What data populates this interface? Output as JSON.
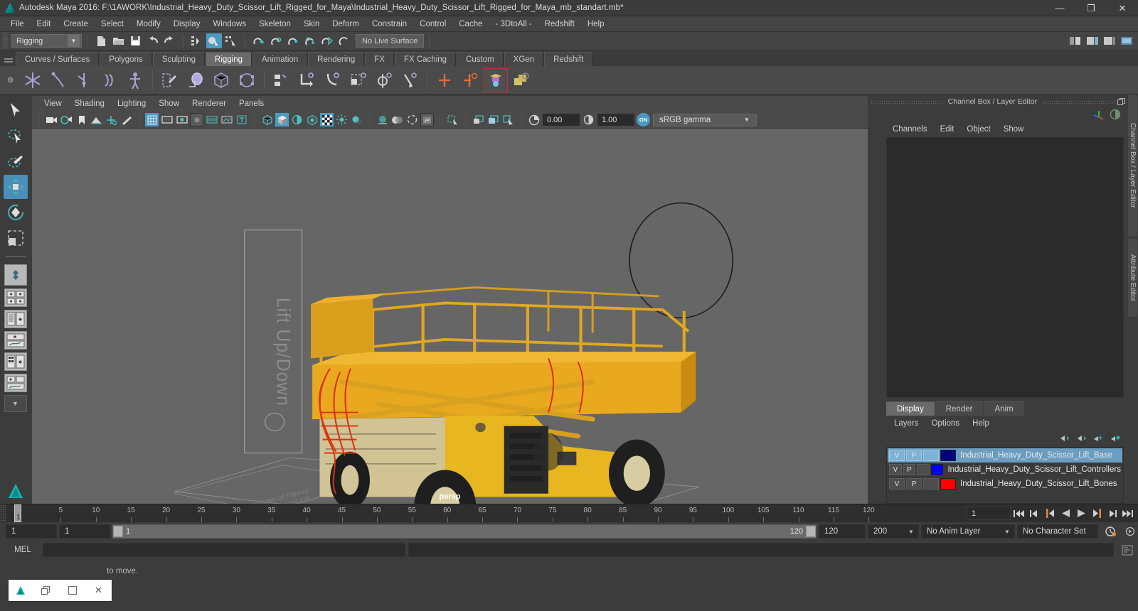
{
  "window": {
    "title": "Autodesk Maya 2016: F:\\1AWORK\\Industrial_Heavy_Duty_Scissor_Lift_Rigged_for_Maya\\Industrial_Heavy_Duty_Scissor_Lift_Rigged_for_Maya_mb_standart.mb*",
    "minimize": "—",
    "maximize": "❐",
    "close": "✕"
  },
  "menubar": {
    "items": [
      "File",
      "Edit",
      "Create",
      "Select",
      "Modify",
      "Display",
      "Windows",
      "Skeleton",
      "Skin",
      "Deform",
      "Constrain",
      "Control",
      "Cache",
      "- 3DtoAll -",
      "Redshift",
      "Help"
    ]
  },
  "statusbar": {
    "menuset": "Rigging",
    "live_surface": "No Live Surface"
  },
  "shelf": {
    "tabs": [
      "Curves / Surfaces",
      "Polygons",
      "Sculpting",
      "Rigging",
      "Animation",
      "Rendering",
      "FX",
      "FX Caching",
      "Custom",
      "XGen",
      "Redshift"
    ],
    "active_tab": "Rigging"
  },
  "viewport": {
    "menus": [
      "View",
      "Shading",
      "Lighting",
      "Show",
      "Renderer",
      "Panels"
    ],
    "exposure": "0.00",
    "gamma": "1.00",
    "color_toggle": "ON",
    "color_profile": "sRGB gamma",
    "camera_label": "persp",
    "scene_text": "Lift Up/Down"
  },
  "channelbox": {
    "title": "Channel Box / Layer Editor",
    "menus": [
      "Channels",
      "Edit",
      "Object",
      "Show"
    ]
  },
  "layer_editor": {
    "tabs": [
      "Display",
      "Render",
      "Anim"
    ],
    "active_tab": "Display",
    "menus": [
      "Layers",
      "Options",
      "Help"
    ],
    "layers": [
      {
        "v": "V",
        "p": "P",
        "color": "#00007f",
        "name": "Industrial_Heavy_Duty_Scissor_Lift_Base",
        "selected": true
      },
      {
        "v": "V",
        "p": "P",
        "color": "#0000ff",
        "name": "Industrial_Heavy_Duty_Scissor_Lift_Controllers",
        "selected": false
      },
      {
        "v": "V",
        "p": "P",
        "color": "#ff0000",
        "name": "Industrial_Heavy_Duty_Scissor_Lift_Bones",
        "selected": false
      }
    ]
  },
  "timeline": {
    "ticks": [
      "5",
      "10",
      "15",
      "20",
      "25",
      "30",
      "35",
      "40",
      "45",
      "50",
      "55",
      "60",
      "65",
      "70",
      "75",
      "80",
      "85",
      "90",
      "95",
      "100",
      "105",
      "110",
      "115",
      "120"
    ],
    "current_frame_marker": "1",
    "current_frame_field": "1"
  },
  "range": {
    "start": "1",
    "anim_start": "1",
    "bar_start": "1",
    "bar_end": "120",
    "anim_end": "120",
    "end": "200",
    "anim_layer": "No Anim Layer",
    "character_set": "No Character Set"
  },
  "command_line": {
    "label": "MEL",
    "value": "",
    "placeholder": ""
  },
  "status_message": "to move.",
  "colors": {
    "accent": "#4a9bc4",
    "selection": "#6b9dc0",
    "panel": "#3c3c3c",
    "viewport_bg": "#666666"
  }
}
